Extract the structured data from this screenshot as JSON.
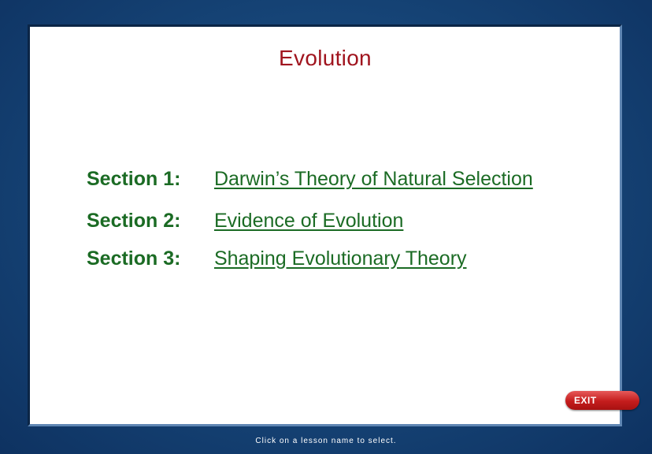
{
  "title": "Evolution",
  "sections": [
    {
      "label": "Section 1:",
      "link": "Darwin’s Theory of Natural Selection"
    },
    {
      "label": "Section 2:",
      "link": "Evidence of Evolution"
    },
    {
      "label": "Section 3:",
      "link": "Shaping Evolutionary Theory"
    }
  ],
  "exit_label": "EXIT",
  "footer_hint": "Click on a lesson name to select.",
  "colors": {
    "title": "#a0141e",
    "section_text": "#1b6b24",
    "background": "#17477a",
    "exit_button": "#c41c1c"
  }
}
